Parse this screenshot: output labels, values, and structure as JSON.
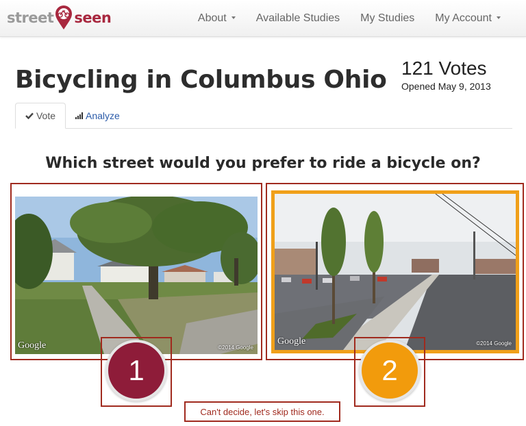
{
  "nav": {
    "logo_left": "street",
    "logo_right": "seen",
    "items": [
      {
        "label": "About",
        "dropdown": true
      },
      {
        "label": "Available Studies",
        "dropdown": false
      },
      {
        "label": "My Studies",
        "dropdown": false
      },
      {
        "label": "My Account",
        "dropdown": true
      }
    ]
  },
  "header": {
    "title": "Bicycling in Columbus Ohio",
    "votes": "121 Votes",
    "opened": "Opened May 9, 2013"
  },
  "tabs": [
    {
      "label": "Vote",
      "icon": "check-icon",
      "active": true
    },
    {
      "label": "Analyze",
      "icon": "bar-chart-icon",
      "active": false
    }
  ],
  "question": "Which street would you prefer to ride a bicycle on?",
  "options": [
    {
      "number": "1",
      "watermark": "Google",
      "copyright": "©2014 Google",
      "color": "#8e1c39"
    },
    {
      "number": "2",
      "watermark": "Google",
      "copyright": "©2014 Google",
      "color": "#f29b0c"
    }
  ],
  "skip_label": "Can't decide, let's skip this one.",
  "colors": {
    "brand": "#a8283f",
    "accent": "#f29b0c",
    "highlight_frame": "#a02a1e"
  }
}
